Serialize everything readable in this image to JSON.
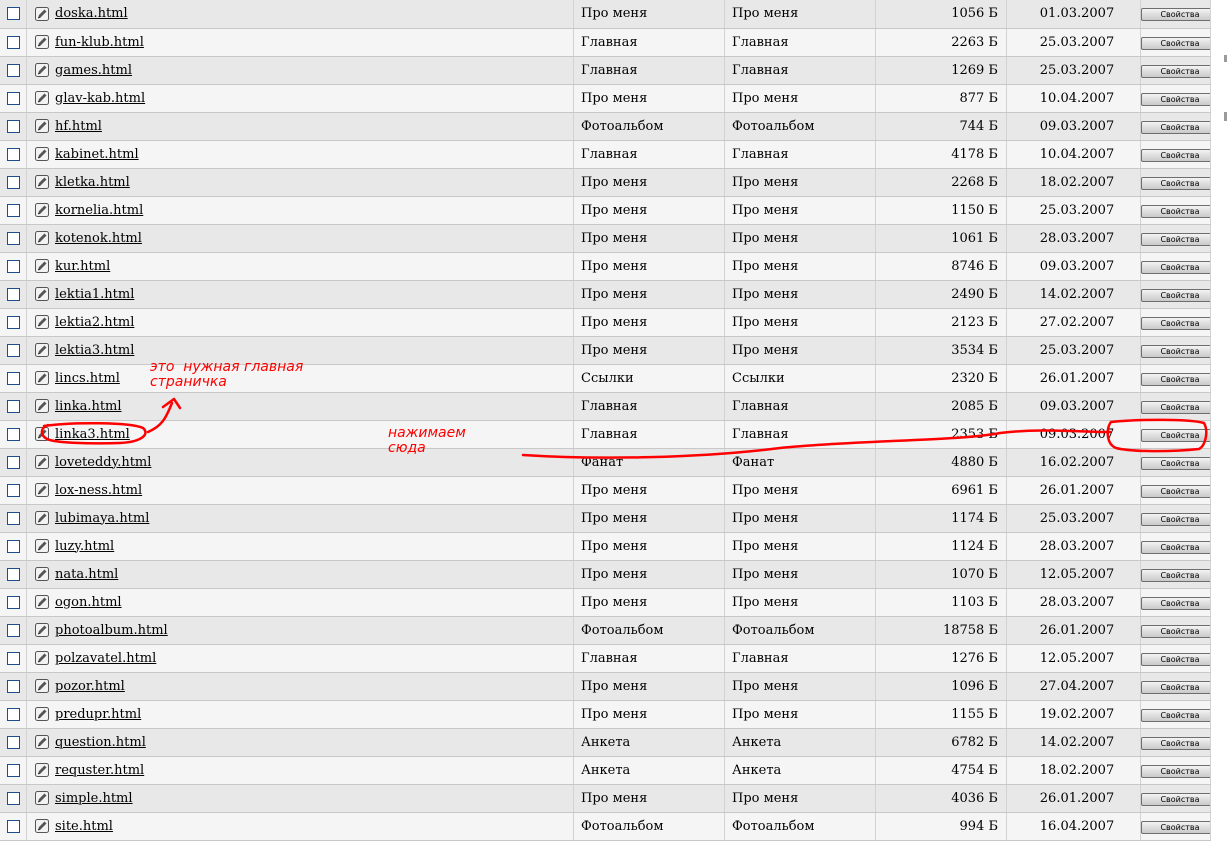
{
  "rows": [
    {
      "name": "doska.html",
      "title": "Про меня",
      "menu": "Про меня",
      "size": "1056 Б",
      "date": "01.03.2007"
    },
    {
      "name": "fun-klub.html",
      "title": "Главная",
      "menu": "Главная",
      "size": "2263 Б",
      "date": "25.03.2007"
    },
    {
      "name": "games.html",
      "title": "Главная",
      "menu": "Главная",
      "size": "1269 Б",
      "date": "25.03.2007"
    },
    {
      "name": "glav-kab.html",
      "title": "Про меня",
      "menu": "Про меня",
      "size": "877 Б",
      "date": "10.04.2007"
    },
    {
      "name": "hf.html",
      "title": "Фотоальбом",
      "menu": "Фотоальбом",
      "size": "744 Б",
      "date": "09.03.2007"
    },
    {
      "name": "kabinet.html",
      "title": "Главная",
      "menu": "Главная",
      "size": "4178 Б",
      "date": "10.04.2007"
    },
    {
      "name": "kletka.html",
      "title": "Про меня",
      "menu": "Про меня",
      "size": "2268 Б",
      "date": "18.02.2007"
    },
    {
      "name": "kornelia.html",
      "title": "Про меня",
      "menu": "Про меня",
      "size": "1150 Б",
      "date": "25.03.2007"
    },
    {
      "name": "kotenok.html",
      "title": "Про меня",
      "menu": "Про меня",
      "size": "1061 Б",
      "date": "28.03.2007"
    },
    {
      "name": "kur.html",
      "title": "Про меня",
      "menu": "Про меня",
      "size": "8746 Б",
      "date": "09.03.2007"
    },
    {
      "name": "lektia1.html",
      "title": "Про меня",
      "menu": "Про меня",
      "size": "2490 Б",
      "date": "14.02.2007"
    },
    {
      "name": "lektia2.html",
      "title": "Про меня",
      "menu": "Про меня",
      "size": "2123 Б",
      "date": "27.02.2007"
    },
    {
      "name": "lektia3.html",
      "title": "Про меня",
      "menu": "Про меня",
      "size": "3534 Б",
      "date": "25.03.2007"
    },
    {
      "name": "lincs.html",
      "title": "Ссылки",
      "menu": "Ссылки",
      "size": "2320 Б",
      "date": "26.01.2007"
    },
    {
      "name": "linka.html",
      "title": "Главная",
      "menu": "Главная",
      "size": "2085 Б",
      "date": "09.03.2007"
    },
    {
      "name": "linka3.html",
      "title": "Главная",
      "menu": "Главная",
      "size": "2353 Б",
      "date": "09.03.2007"
    },
    {
      "name": "loveteddy.html",
      "title": "Фанат",
      "menu": "Фанат",
      "size": "4880 Б",
      "date": "16.02.2007"
    },
    {
      "name": "lox-ness.html",
      "title": "Про меня",
      "menu": "Про меня",
      "size": "6961 Б",
      "date": "26.01.2007"
    },
    {
      "name": "lubimaya.html",
      "title": "Про меня",
      "menu": "Про меня",
      "size": "1174 Б",
      "date": "25.03.2007"
    },
    {
      "name": "luzy.html",
      "title": "Про меня",
      "menu": "Про меня",
      "size": "1124 Б",
      "date": "28.03.2007"
    },
    {
      "name": "nata.html",
      "title": "Про меня",
      "menu": "Про меня",
      "size": "1070 Б",
      "date": "12.05.2007"
    },
    {
      "name": "ogon.html",
      "title": "Про меня",
      "menu": "Про меня",
      "size": "1103 Б",
      "date": "28.03.2007"
    },
    {
      "name": "photoalbum.html",
      "title": "Фотоальбом",
      "menu": "Фотоальбом",
      "size": "18758 Б",
      "date": "26.01.2007"
    },
    {
      "name": "polzavatel.html",
      "title": "Главная",
      "menu": "Главная",
      "size": "1276 Б",
      "date": "12.05.2007"
    },
    {
      "name": "pozor.html",
      "title": "Про меня",
      "menu": "Про меня",
      "size": "1096 Б",
      "date": "27.04.2007"
    },
    {
      "name": "predupr.html",
      "title": "Про меня",
      "menu": "Про меня",
      "size": "1155 Б",
      "date": "19.02.2007"
    },
    {
      "name": "question.html",
      "title": "Анкета",
      "menu": "Анкета",
      "size": "6782 Б",
      "date": "14.02.2007"
    },
    {
      "name": "requster.html",
      "title": "Анкета",
      "menu": "Анкета",
      "size": "4754 Б",
      "date": "18.02.2007"
    },
    {
      "name": "simple.html",
      "title": "Про меня",
      "menu": "Про меня",
      "size": "4036 Б",
      "date": "26.01.2007"
    },
    {
      "name": "site.html",
      "title": "Фотоальбом",
      "menu": "Фотоальбом",
      "size": "994 Б",
      "date": "16.04.2007"
    }
  ],
  "button_label": "Свойства",
  "annotations": {
    "main_page_note": "это  нужная главная\nстраничка",
    "click_here_note": "нажимаем\nсюда"
  },
  "colors": {
    "annotation": "#ff0000",
    "checkbox_border": "#1c4f8a",
    "row_even": "#e8e8e8",
    "row_odd": "#f5f5f5"
  },
  "icons": {
    "edit": "edit-page-icon"
  }
}
